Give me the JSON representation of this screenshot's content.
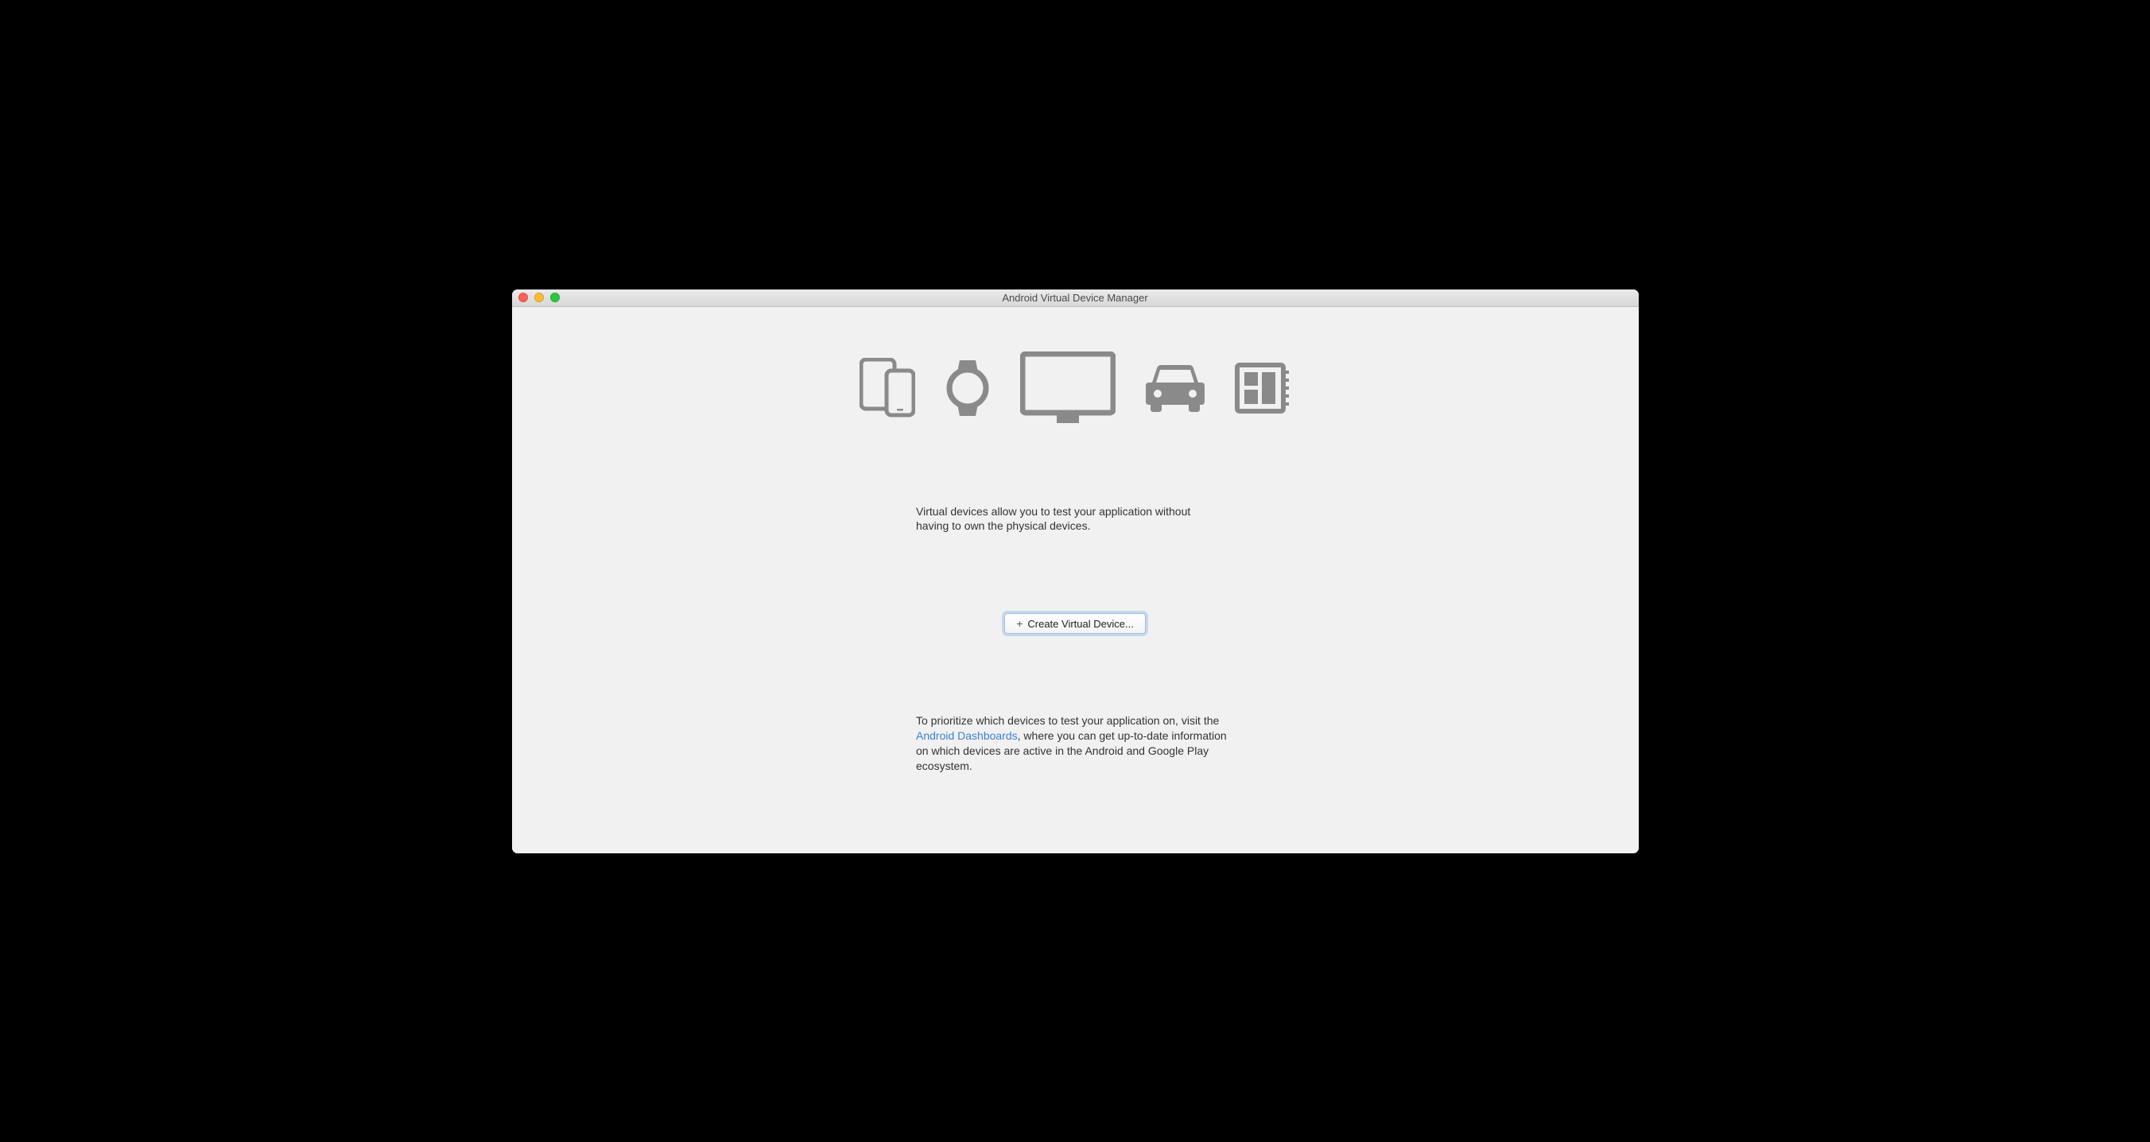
{
  "window": {
    "title": "Android Virtual Device Manager"
  },
  "content": {
    "intro_line1": "Virtual devices allow you to test your application without",
    "intro_line2": "having to own the physical devices.",
    "create_button": "Create Virtual Device...",
    "help_pre": "To prioritize which devices to test your application on, visit the ",
    "help_link": "Android Dashboards",
    "help_post": ", where you can get up-to-date information on which devices are active in the Android and Google Play ecosystem."
  }
}
